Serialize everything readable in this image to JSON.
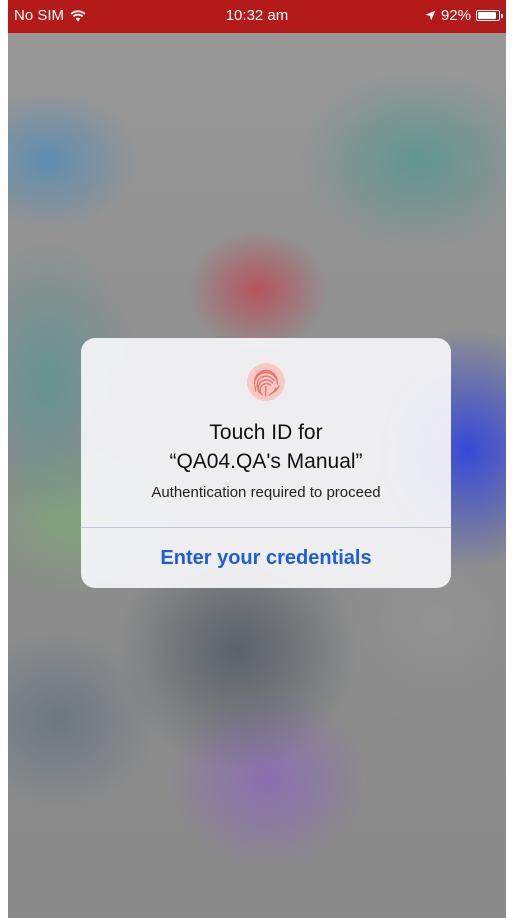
{
  "status_bar": {
    "carrier": "No SIM",
    "time": "10:32 am",
    "battery_percent": "92%",
    "battery_level": 0.92,
    "background_color": "#b51a1a",
    "icons": [
      "wifi-icon",
      "location-arrow-icon",
      "battery-icon"
    ]
  },
  "alert": {
    "icon": "fingerprint-icon",
    "icon_color": "#e8736f",
    "title_line1": "Touch ID for",
    "title_line2": "“QA04.QA's Manual”",
    "message": "Authentication required to proceed",
    "action_label": "Enter your credentials",
    "action_color": "#1f5fd6"
  }
}
